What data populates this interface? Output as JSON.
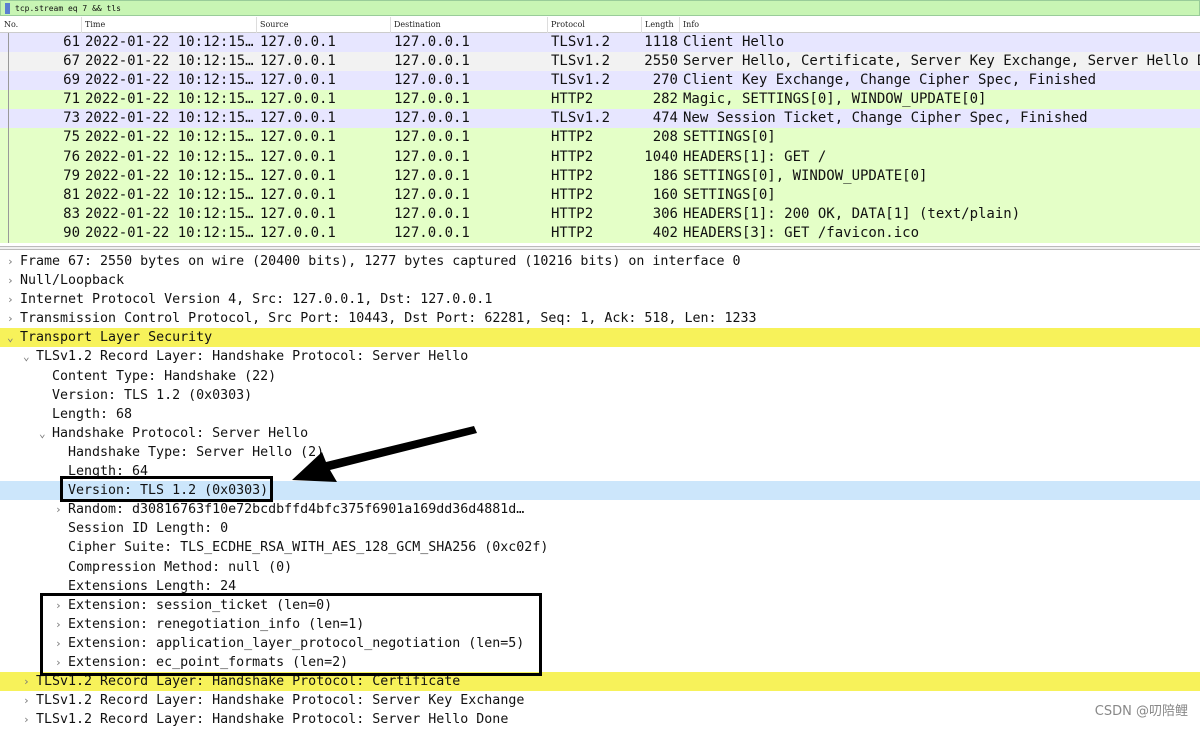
{
  "filter": {
    "value": "tcp.stream eq 7 && tls"
  },
  "columns": [
    "No.",
    "Time",
    "Source",
    "Destination",
    "Protocol",
    "Length",
    "Info"
  ],
  "packets": [
    {
      "no": "61",
      "time": "2022-01-22 10:12:15…",
      "src": "127.0.0.1",
      "dst": "127.0.0.1",
      "proto": "TLSv1.2",
      "len": "1118",
      "info": "Client Hello",
      "cls": "tls"
    },
    {
      "no": "67",
      "time": "2022-01-22 10:12:15…",
      "src": "127.0.0.1",
      "dst": "127.0.0.1",
      "proto": "TLSv1.2",
      "len": "2550",
      "info": "Server Hello, Certificate, Server Key Exchange, Server Hello Done",
      "cls": "sel"
    },
    {
      "no": "69",
      "time": "2022-01-22 10:12:15…",
      "src": "127.0.0.1",
      "dst": "127.0.0.1",
      "proto": "TLSv1.2",
      "len": "270",
      "info": "Client Key Exchange, Change Cipher Spec, Finished",
      "cls": "tls"
    },
    {
      "no": "71",
      "time": "2022-01-22 10:12:15…",
      "src": "127.0.0.1",
      "dst": "127.0.0.1",
      "proto": "HTTP2",
      "len": "282",
      "info": "Magic, SETTINGS[0], WINDOW_UPDATE[0]",
      "cls": "http"
    },
    {
      "no": "73",
      "time": "2022-01-22 10:12:15…",
      "src": "127.0.0.1",
      "dst": "127.0.0.1",
      "proto": "TLSv1.2",
      "len": "474",
      "info": "New Session Ticket, Change Cipher Spec, Finished",
      "cls": "tls"
    },
    {
      "no": "75",
      "time": "2022-01-22 10:12:15…",
      "src": "127.0.0.1",
      "dst": "127.0.0.1",
      "proto": "HTTP2",
      "len": "208",
      "info": "SETTINGS[0]",
      "cls": "http"
    },
    {
      "no": "76",
      "time": "2022-01-22 10:12:15…",
      "src": "127.0.0.1",
      "dst": "127.0.0.1",
      "proto": "HTTP2",
      "len": "1040",
      "info": "HEADERS[1]: GET /",
      "cls": "http"
    },
    {
      "no": "79",
      "time": "2022-01-22 10:12:15…",
      "src": "127.0.0.1",
      "dst": "127.0.0.1",
      "proto": "HTTP2",
      "len": "186",
      "info": "SETTINGS[0], WINDOW_UPDATE[0]",
      "cls": "http"
    },
    {
      "no": "81",
      "time": "2022-01-22 10:12:15…",
      "src": "127.0.0.1",
      "dst": "127.0.0.1",
      "proto": "HTTP2",
      "len": "160",
      "info": "SETTINGS[0]",
      "cls": "http"
    },
    {
      "no": "83",
      "time": "2022-01-22 10:12:15…",
      "src": "127.0.0.1",
      "dst": "127.0.0.1",
      "proto": "HTTP2",
      "len": "306",
      "info": "HEADERS[1]: 200 OK, DATA[1] (text/plain)",
      "cls": "http"
    },
    {
      "no": "90",
      "time": "2022-01-22 10:12:15…",
      "src": "127.0.0.1",
      "dst": "127.0.0.1",
      "proto": "HTTP2",
      "len": "402",
      "info": "HEADERS[3]: GET /favicon.ico",
      "cls": "http"
    }
  ],
  "details": [
    {
      "level": 0,
      "arrow": "›",
      "text": "Frame 67: 2550 bytes on wire (20400 bits), 1277 bytes captured (10216 bits) on interface 0"
    },
    {
      "level": 0,
      "arrow": "›",
      "text": "Null/Loopback"
    },
    {
      "level": 0,
      "arrow": "›",
      "text": "Internet Protocol Version 4, Src: 127.0.0.1, Dst: 127.0.0.1"
    },
    {
      "level": 0,
      "arrow": "›",
      "text": "Transmission Control Protocol, Src Port: 10443, Dst Port: 62281, Seq: 1, Ack: 518, Len: 1233"
    },
    {
      "level": 0,
      "arrow": "⌄",
      "text": "Transport Layer Security",
      "hl": "y"
    },
    {
      "level": 1,
      "arrow": "⌄",
      "text": "TLSv1.2 Record Layer: Handshake Protocol: Server Hello"
    },
    {
      "level": 2,
      "arrow": "",
      "text": "Content Type: Handshake (22)"
    },
    {
      "level": 2,
      "arrow": "",
      "text": "Version: TLS 1.2 (0x0303)"
    },
    {
      "level": 2,
      "arrow": "",
      "text": "Length: 68"
    },
    {
      "level": 2,
      "arrow": "⌄",
      "text": "Handshake Protocol: Server Hello"
    },
    {
      "level": 3,
      "arrow": "",
      "text": "Handshake Type: Server Hello (2)"
    },
    {
      "level": 3,
      "arrow": "",
      "text": "Length: 64"
    },
    {
      "level": 3,
      "arrow": "",
      "text": "Version: TLS 1.2 (0x0303)",
      "hl": "b"
    },
    {
      "level": 3,
      "arrow": "›",
      "text": "Random: d30816763f10e72bcdbffd4bfc375f6901a169dd36d4881d…"
    },
    {
      "level": 3,
      "arrow": "",
      "text": "Session ID Length: 0"
    },
    {
      "level": 3,
      "arrow": "",
      "text": "Cipher Suite: TLS_ECDHE_RSA_WITH_AES_128_GCM_SHA256 (0xc02f)"
    },
    {
      "level": 3,
      "arrow": "",
      "text": "Compression Method: null (0)"
    },
    {
      "level": 3,
      "arrow": "",
      "text": "Extensions Length: 24"
    },
    {
      "level": 3,
      "arrow": "›",
      "text": "Extension: session_ticket (len=0)"
    },
    {
      "level": 3,
      "arrow": "›",
      "text": "Extension: renegotiation_info (len=1)"
    },
    {
      "level": 3,
      "arrow": "›",
      "text": "Extension: application_layer_protocol_negotiation (len=5)"
    },
    {
      "level": 3,
      "arrow": "›",
      "text": "Extension: ec_point_formats (len=2)"
    },
    {
      "level": 1,
      "arrow": "›",
      "text": "TLSv1.2 Record Layer: Handshake Protocol: Certificate",
      "hl": "y"
    },
    {
      "level": 1,
      "arrow": "›",
      "text": "TLSv1.2 Record Layer: Handshake Protocol: Server Key Exchange"
    },
    {
      "level": 1,
      "arrow": "›",
      "text": "TLSv1.2 Record Layer: Handshake Protocol: Server Hello Done"
    }
  ],
  "watermark": "CSDN @叨陪鲤"
}
